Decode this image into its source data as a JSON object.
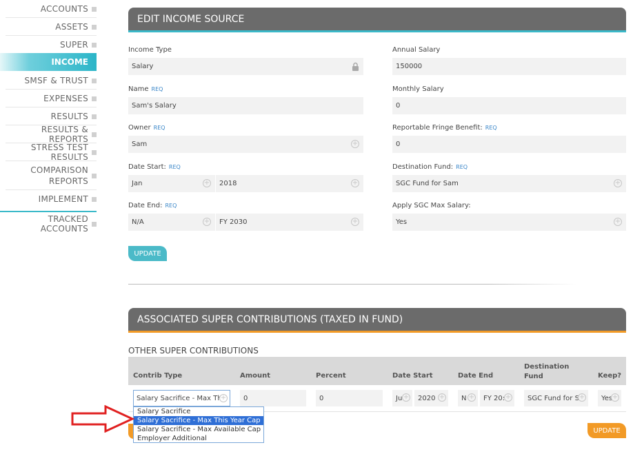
{
  "sidebar": {
    "items": [
      {
        "label": "ACCOUNTS"
      },
      {
        "label": "ASSETS"
      },
      {
        "label": "SUPER"
      },
      {
        "label": "INCOME"
      },
      {
        "label": "SMSF & TRUST"
      },
      {
        "label": "EXPENSES"
      },
      {
        "label": "RESULTS"
      },
      {
        "label": "RESULTS & REPORTS"
      },
      {
        "label": "STRESS TEST RESULTS"
      },
      {
        "label_line1": "COMPARISON",
        "label_line2": "REPORTS"
      },
      {
        "label": "IMPLEMENT"
      },
      {
        "label": "TRACKED ACCOUNTS"
      }
    ],
    "active": "INCOME"
  },
  "edit_income": {
    "title": "EDIT INCOME SOURCE",
    "req": "REQ",
    "income_type": {
      "label": "Income Type",
      "value": "Salary"
    },
    "name": {
      "label": "Name",
      "value": "Sam's Salary"
    },
    "owner": {
      "label": "Owner",
      "value": "Sam"
    },
    "date_start": {
      "label": "Date Start:",
      "month": "Jan",
      "year": "2018"
    },
    "date_end": {
      "label": "Date End:",
      "month": "N/A",
      "year": "FY 2030"
    },
    "annual_salary": {
      "label": "Annual Salary",
      "value": "150000"
    },
    "monthly_salary": {
      "label": "Monthly Salary",
      "value": "0"
    },
    "fringe": {
      "label": "Reportable Fringe Benefit:",
      "value": "0"
    },
    "destination_fund": {
      "label": "Destination Fund:",
      "value": "SGC Fund for Sam"
    },
    "apply_sgc": {
      "label": "Apply SGC Max Salary:",
      "value": "Yes"
    },
    "update_label": "UPDATE"
  },
  "super_contrib": {
    "title": "ASSOCIATED SUPER CONTRIBUTIONS (TAXED IN FUND)",
    "section_title": "OTHER SUPER CONTRIBUTIONS",
    "columns": {
      "contrib_type": "Contrib Type",
      "amount": "Amount",
      "percent": "Percent",
      "date_start": "Date Start",
      "date_end": "Date End",
      "destination_line1": "Destination",
      "destination_line2": "Fund",
      "keep": "Keep?"
    },
    "row": {
      "contrib_type": "Salary Sacrifice - Max Th",
      "amount": "0",
      "percent": "0",
      "start_month": "Ju",
      "start_year": "2020",
      "end_month": "N",
      "end_year": "FY 20:",
      "destination": "SGC Fund for S",
      "keep": "Yes"
    },
    "dropdown_options": [
      "Salary Sacrifice",
      "Salary Sacrifice - Max This Year Cap",
      "Salary Sacrifice - Max Available Cap",
      "Employer Additional"
    ],
    "selected_option_index": 1,
    "update_label": "UPDATE"
  },
  "colors": {
    "accent_teal": "#3ab9c9",
    "accent_orange": "#f29a26",
    "header_gray": "#6b6b6b",
    "arrow_red": "#e02020"
  }
}
